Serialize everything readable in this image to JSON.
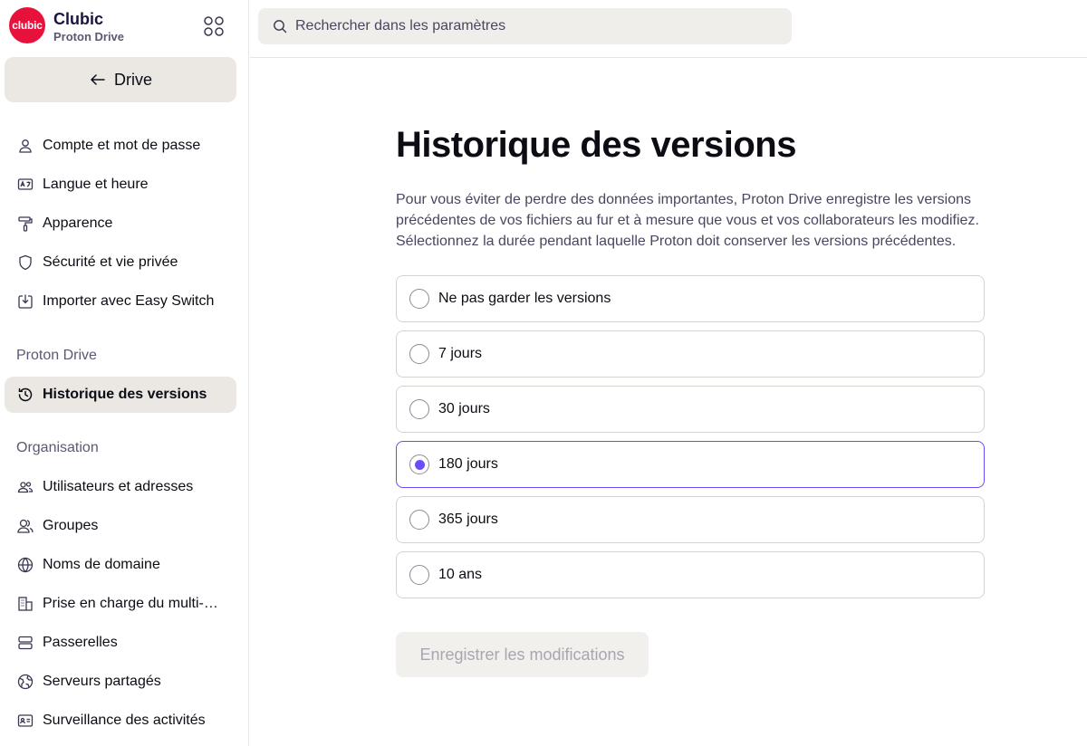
{
  "brand": {
    "logo_text": "clubic",
    "name": "Clubic",
    "product": "Proton Drive",
    "logo_color": "#e8113b"
  },
  "sidebar": {
    "back_label": "Drive",
    "account_items": [
      {
        "label": "Compte et mot de passe",
        "icon": "user-icon"
      },
      {
        "label": "Langue et heure",
        "icon": "language-icon"
      },
      {
        "label": "Apparence",
        "icon": "paint-roller-icon"
      },
      {
        "label": "Sécurité et vie privée",
        "icon": "shield-icon"
      },
      {
        "label": "Importer avec Easy Switch",
        "icon": "import-icon"
      }
    ],
    "drive_section_title": "Proton Drive",
    "drive_items": [
      {
        "label": "Historique des versions",
        "icon": "history-icon",
        "active": true
      }
    ],
    "org_section_title": "Organisation",
    "org_items": [
      {
        "label": "Utilisateurs et adresses",
        "icon": "users-icon"
      },
      {
        "label": "Groupes",
        "icon": "groups-icon"
      },
      {
        "label": "Noms de domaine",
        "icon": "globe-icon"
      },
      {
        "label": "Prise en charge du multi-…",
        "icon": "buildings-icon"
      },
      {
        "label": "Passerelles",
        "icon": "servers-icon"
      },
      {
        "label": "Serveurs partagés",
        "icon": "globe-network-icon"
      },
      {
        "label": "Surveillance des activités",
        "icon": "id-card-icon"
      }
    ]
  },
  "search": {
    "placeholder": "Rechercher dans les paramètres",
    "value": ""
  },
  "main": {
    "title": "Historique des versions",
    "description": "Pour vous éviter de perdre des données importantes, Proton Drive enregistre les versions précédentes de vos fichiers au fur et à mesure que vous et vos collaborateurs les modifiez. Sélectionnez la durée pendant laquelle Proton doit conserver les versions précédentes.",
    "options": [
      {
        "label": "Ne pas garder les versions",
        "selected": false
      },
      {
        "label": "7 jours",
        "selected": false
      },
      {
        "label": "30 jours",
        "selected": false
      },
      {
        "label": "180 jours",
        "selected": true
      },
      {
        "label": "365 jours",
        "selected": false
      },
      {
        "label": "10 ans",
        "selected": false
      }
    ],
    "save_label": "Enregistrer les modifications"
  },
  "colors": {
    "accent": "#6d4aff",
    "active_bg": "#ebe8e3"
  }
}
